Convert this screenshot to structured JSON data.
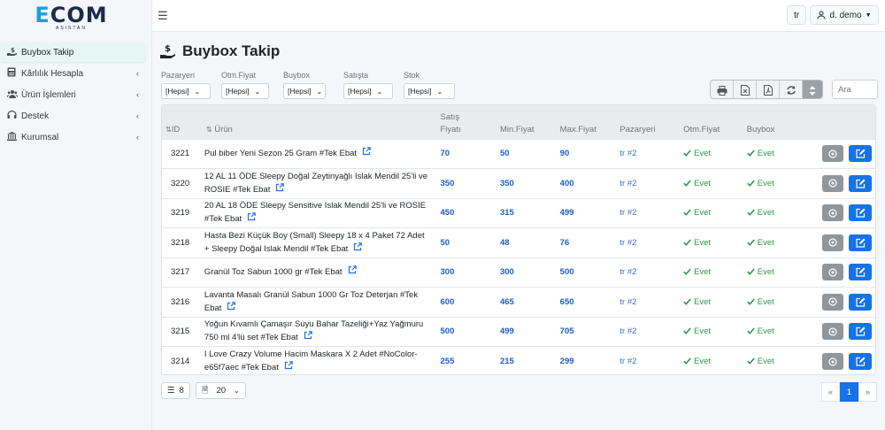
{
  "brand": {
    "logo_e": "E",
    "logo_rest": "COM",
    "tagline": "ASISTAN"
  },
  "sidebar": {
    "items": [
      {
        "label": "Buybox Takip",
        "icon": "hand-dollar-icon",
        "active": true,
        "chevron": ""
      },
      {
        "label": "Kârlılık Hesapla",
        "icon": "calculator-icon",
        "active": false,
        "chevron": "‹"
      },
      {
        "label": "Ürün İşlemleri",
        "icon": "users-icon",
        "active": false,
        "chevron": "‹"
      },
      {
        "label": "Destek",
        "icon": "support-icon",
        "active": false,
        "chevron": "‹"
      },
      {
        "label": "Kurumsal",
        "icon": "bank-icon",
        "active": false,
        "chevron": "‹"
      }
    ]
  },
  "topbar": {
    "lang": "tr",
    "user": "d. demo"
  },
  "page": {
    "title": "Buybox Takip"
  },
  "filters": [
    {
      "label": "Pazaryeri",
      "value": "[Hepsi]"
    },
    {
      "label": "Otm.Fiyat",
      "value": "[Hepsi]"
    },
    {
      "label": "Buybox",
      "value": "[Hepsi]"
    },
    {
      "label": "Satışta",
      "value": "[Hepsi]"
    },
    {
      "label": "Stok",
      "value": "[Hepsi]"
    }
  ],
  "search": {
    "placeholder": "Ara"
  },
  "table": {
    "headers": {
      "id": "ID",
      "product": "Ürün",
      "sale_a": "Satış",
      "sale_b": "Fiyatı",
      "min": "Min.Fiyat",
      "max": "Max.Fiyat",
      "market": "Pazaryeri",
      "auto": "Otm.Fiyat",
      "buybox": "Buybox"
    },
    "rows": [
      {
        "id": "3221",
        "product": "Pul biber Yeni Sezon 25 Gram #Tek Ebat",
        "sale": "70",
        "min": "50",
        "max": "90",
        "market": "tr #2",
        "auto": "Evet",
        "buybox": "Evet"
      },
      {
        "id": "3220",
        "product": "12 AL 11 ÖDE Sleepy Doğal Zeytinyağlı Islak Mendil 25'li ve ROSIE #Tek Ebat",
        "sale": "350",
        "min": "350",
        "max": "400",
        "market": "tr #2",
        "auto": "Evet",
        "buybox": "Evet"
      },
      {
        "id": "3219",
        "product": "20 AL 18 ÖDE Sleepy Sensitive Islak Mendil 25'li ve ROSIE #Tek Ebat",
        "sale": "450",
        "min": "315",
        "max": "499",
        "market": "tr #2",
        "auto": "Evet",
        "buybox": "Evet"
      },
      {
        "id": "3218",
        "product": "Hasta Bezi Küçük Boy (Small) Sleepy 18 x 4 Paket 72 Adet + Sleepy Doğal Islak Mendil #Tek Ebat",
        "sale": "50",
        "min": "48",
        "max": "76",
        "market": "tr #2",
        "auto": "Evet",
        "buybox": "Evet"
      },
      {
        "id": "3217",
        "product": "Granül Toz Sabun 1000 gr #Tek Ebat",
        "sale": "300",
        "min": "300",
        "max": "500",
        "market": "tr #2",
        "auto": "Evet",
        "buybox": "Evet"
      },
      {
        "id": "3216",
        "product": "Lavanta Masalı Granül Sabun 1000 Gr Toz Deterjan #Tek Ebat",
        "sale": "600",
        "min": "465",
        "max": "650",
        "market": "tr #2",
        "auto": "Evet",
        "buybox": "Evet"
      },
      {
        "id": "3215",
        "product": "Yoğun Kıvamlı Çamaşır Suyu Bahar Tazeliği+Yaz Yağmuru 750 ml 4'lü set #Tek Ebat",
        "sale": "500",
        "min": "499",
        "max": "705",
        "market": "tr #2",
        "auto": "Evet",
        "buybox": "Evet"
      },
      {
        "id": "3214",
        "product": "I Love Crazy Volume Hacim Maskara X 2 Adet #NoColor-e65f7aec #Tek Ebat",
        "sale": "255",
        "min": "215",
        "max": "299",
        "market": "tr #2",
        "auto": "Evet",
        "buybox": "Evet"
      }
    ]
  },
  "footer": {
    "count": "8",
    "page_size": "20"
  },
  "pagination": {
    "prev": "«",
    "current": "1",
    "next": "»"
  },
  "colors": {
    "accent": "#1672e8",
    "success": "#2c9a4d",
    "muted_btn": "#8f969c",
    "active_nav": "#e6f7f3"
  }
}
